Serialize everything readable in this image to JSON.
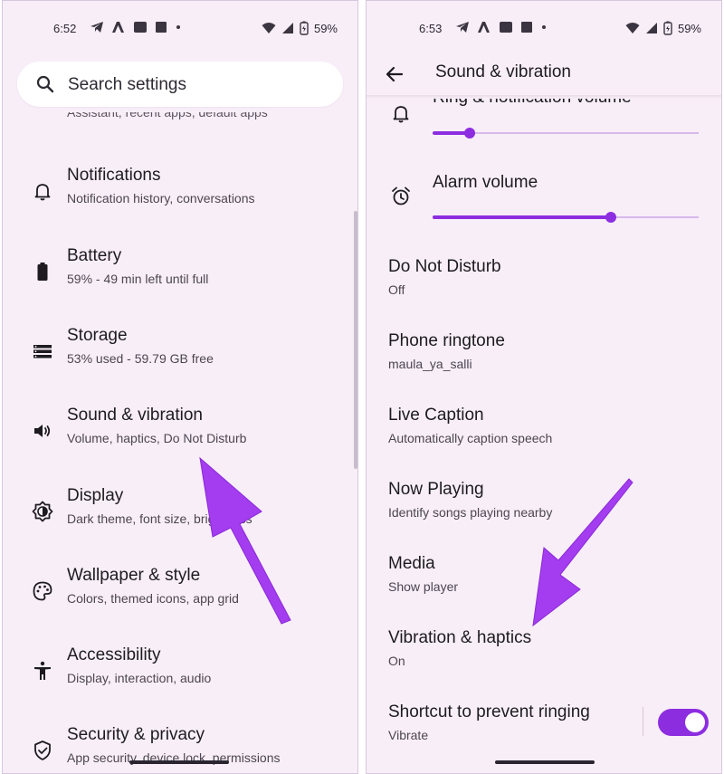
{
  "left": {
    "status": {
      "time": "6:52",
      "battery": "59%"
    },
    "search": {
      "placeholder": "Search settings"
    },
    "clipped_row": "Assistant, recent apps, default apps",
    "items": [
      {
        "title": "Notifications",
        "subtitle": "Notification history, conversations",
        "icon": "bell-icon"
      },
      {
        "title": "Battery",
        "subtitle": "59% - 49 min left until full",
        "icon": "battery-icon"
      },
      {
        "title": "Storage",
        "subtitle": "53% used - 59.79 GB free",
        "icon": "storage-icon"
      },
      {
        "title": "Sound & vibration",
        "subtitle": "Volume, haptics, Do Not Disturb",
        "icon": "speaker-icon"
      },
      {
        "title": "Display",
        "subtitle": "Dark theme, font size, brightness",
        "icon": "brightness-icon"
      },
      {
        "title": "Wallpaper & style",
        "subtitle": "Colors, themed icons, app grid",
        "icon": "palette-icon"
      },
      {
        "title": "Accessibility",
        "subtitle": "Display, interaction, audio",
        "icon": "accessibility-icon"
      },
      {
        "title": "Security & privacy",
        "subtitle": "App security, device lock, permissions",
        "icon": "shield-icon"
      }
    ]
  },
  "right": {
    "status": {
      "time": "6:53",
      "battery": "59%"
    },
    "appbar": {
      "title": "Sound & vibration"
    },
    "sliders": [
      {
        "title": "Ring & notification volume",
        "icon": "bell-icon",
        "level": 0.14
      },
      {
        "title": "Alarm volume",
        "icon": "alarm-icon",
        "level": 0.67
      }
    ],
    "items": [
      {
        "title": "Do Not Disturb",
        "subtitle": "Off"
      },
      {
        "title": "Phone ringtone",
        "subtitle": "maula_ya_salli"
      },
      {
        "title": "Live Caption",
        "subtitle": "Automatically caption speech"
      },
      {
        "title": "Now Playing",
        "subtitle": "Identify songs playing nearby"
      },
      {
        "title": "Media",
        "subtitle": "Show player"
      },
      {
        "title": "Vibration & haptics",
        "subtitle": "On"
      },
      {
        "title": "Shortcut to prevent ringing",
        "subtitle": "Vibrate"
      }
    ],
    "shortcut_toggle_on": true
  },
  "colors": {
    "accent": "#8d2de0",
    "arrow": "#a43cf0",
    "surface": "#f8eef8"
  }
}
